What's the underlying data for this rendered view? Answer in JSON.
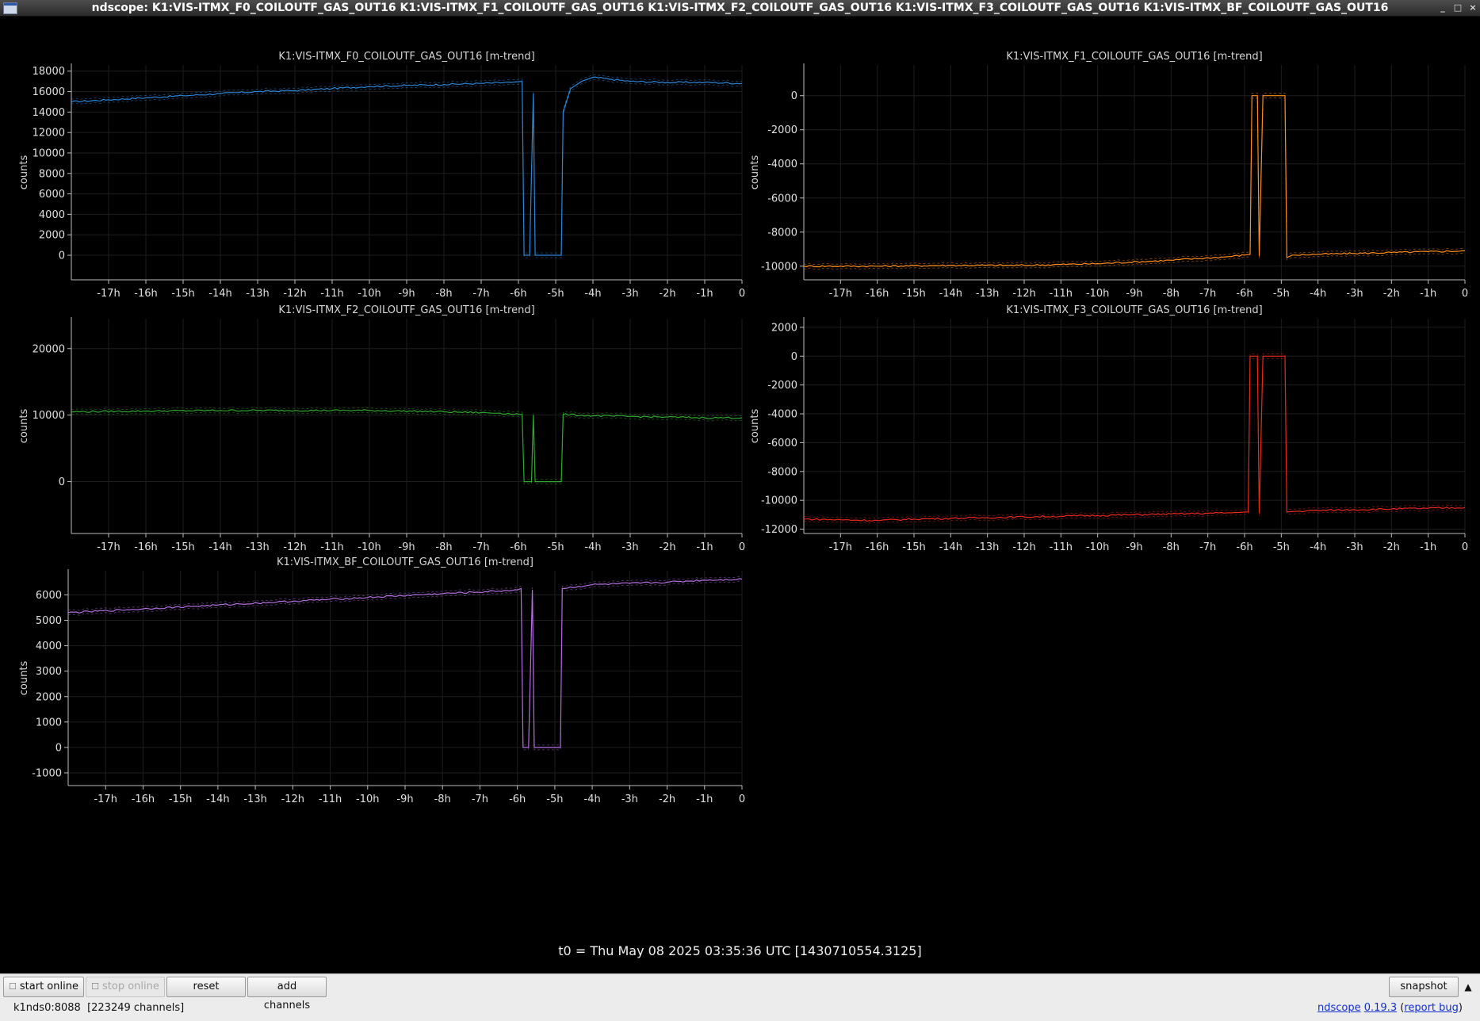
{
  "window": {
    "title": "ndscope: K1:VIS-ITMX_F0_COILOUTF_GAS_OUT16 K1:VIS-ITMX_F1_COILOUTF_GAS_OUT16 K1:VIS-ITMX_F2_COILOUTF_GAS_OUT16 K1:VIS-ITMX_F3_COILOUTF_GAS_OUT16 K1:VIS-ITMX_BF_COILOUTF_GAS_OUT16",
    "controls": {
      "minimize": "_",
      "maximize": "□",
      "close": "×"
    }
  },
  "x_ticks": [
    "-17h",
    "-16h",
    "-15h",
    "-14h",
    "-13h",
    "-12h",
    "-11h",
    "-10h",
    "-9h",
    "-8h",
    "-7h",
    "-6h",
    "-5h",
    "-4h",
    "-3h",
    "-2h",
    "-1h",
    "0"
  ],
  "plots": [
    {
      "title": "K1:VIS-ITMX_F0_COILOUTF_GAS_OUT16 [m-trend]",
      "ylabel": "counts",
      "color": "#2b86d9",
      "yticks": [
        "18000",
        "16000",
        "14000",
        "12000",
        "10000",
        "8000",
        "6000",
        "4000",
        "2000",
        "0"
      ]
    },
    {
      "title": "K1:VIS-ITMX_F1_COILOUTF_GAS_OUT16 [m-trend]",
      "ylabel": "counts",
      "color": "#ff8c1a",
      "yticks": [
        "0",
        "-2000",
        "-4000",
        "-6000",
        "-8000",
        "-10000"
      ]
    },
    {
      "title": "K1:VIS-ITMX_F2_COILOUTF_GAS_OUT16 [m-trend]",
      "ylabel": "counts",
      "color": "#2ea82e",
      "yticks": [
        "20000",
        "10000",
        "0"
      ]
    },
    {
      "title": "K1:VIS-ITMX_F3_COILOUTF_GAS_OUT16 [m-trend]",
      "ylabel": "counts",
      "color": "#e8281e",
      "yticks": [
        "2000",
        "0",
        "-2000",
        "-4000",
        "-6000",
        "-8000",
        "-10000",
        "-12000"
      ]
    },
    {
      "title": "K1:VIS-ITMX_BF_COILOUTF_GAS_OUT16 [m-trend]",
      "ylabel": "counts",
      "color": "#b36ee0",
      "yticks": [
        "6000",
        "5000",
        "4000",
        "3000",
        "2000",
        "1000",
        "0",
        "-1000"
      ]
    }
  ],
  "chart_data": [
    {
      "type": "line",
      "title": "K1:VIS-ITMX_F0_COILOUTF_GAS_OUT16 [m-trend]",
      "xlabel": "",
      "ylabel": "counts",
      "xlim": [
        -18,
        0
      ],
      "ylim": [
        -2400,
        18600
      ],
      "grid": true,
      "series": [
        {
          "x": [
            -18,
            -17,
            -16,
            -15,
            -14,
            -13,
            -12,
            -11,
            -10,
            -9,
            -8,
            -7,
            -6.2,
            -5.9,
            -5.85,
            -5.7,
            -5.6,
            -5.55,
            -5.4,
            -4.85,
            -4.8,
            -4.6,
            -4.3,
            -4,
            -3.5,
            -3,
            -2,
            -1,
            0
          ],
          "y": [
            15000,
            15200,
            15400,
            15600,
            15800,
            16000,
            16100,
            16300,
            16500,
            16600,
            16700,
            16800,
            16900,
            17000,
            0,
            0,
            15800,
            0,
            0,
            0,
            14000,
            16300,
            17000,
            17400,
            17200,
            17000,
            16900,
            16900,
            16800
          ]
        }
      ]
    },
    {
      "type": "line",
      "title": "K1:VIS-ITMX_F1_COILOUTF_GAS_OUT16 [m-trend]",
      "xlabel": "",
      "ylabel": "counts",
      "xlim": [
        -18,
        0
      ],
      "ylim": [
        -10800,
        1800
      ],
      "grid": true,
      "series": [
        {
          "x": [
            -18,
            -16,
            -14,
            -12,
            -10,
            -8,
            -6.5,
            -6,
            -5.85,
            -5.8,
            -5.65,
            -5.6,
            -5.5,
            -5.45,
            -5.4,
            -4.9,
            -4.85,
            -4.7,
            -4,
            -3,
            -2,
            -1,
            0
          ],
          "y": [
            -10000,
            -10000,
            -9950,
            -9950,
            -9850,
            -9650,
            -9450,
            -9350,
            -9300,
            0,
            0,
            -9400,
            0,
            0,
            0,
            0,
            -9500,
            -9350,
            -9300,
            -9250,
            -9200,
            -9150,
            -9100
          ]
        }
      ]
    },
    {
      "type": "line",
      "title": "K1:VIS-ITMX_F2_COILOUTF_GAS_OUT16 [m-trend]",
      "xlabel": "",
      "ylabel": "counts",
      "xlim": [
        -18,
        0
      ],
      "ylim": [
        -7800,
        24500
      ],
      "grid": true,
      "series": [
        {
          "x": [
            -18,
            -16,
            -14,
            -12,
            -10,
            -8,
            -6.5,
            -5.9,
            -5.85,
            -5.65,
            -5.6,
            -5.55,
            -5.4,
            -4.85,
            -4.8,
            -4,
            -3,
            -2,
            -1,
            0
          ],
          "y": [
            10500,
            10600,
            10700,
            10700,
            10700,
            10500,
            10300,
            10100,
            0,
            0,
            10000,
            0,
            0,
            0,
            10100,
            9900,
            9800,
            9700,
            9600,
            9600
          ]
        }
      ]
    },
    {
      "type": "line",
      "title": "K1:VIS-ITMX_F3_COILOUTF_GAS_OUT16 [m-trend]",
      "xlabel": "",
      "ylabel": "counts",
      "xlim": [
        -18,
        0
      ],
      "ylim": [
        -12300,
        2600
      ],
      "grid": true,
      "series": [
        {
          "x": [
            -18,
            -17,
            -16,
            -15,
            -14,
            -13,
            -12,
            -11,
            -10,
            -9,
            -8,
            -7,
            -6.2,
            -5.9,
            -5.85,
            -5.65,
            -5.6,
            -5.5,
            -5.4,
            -4.9,
            -4.85,
            -4.5,
            -4,
            -3,
            -2,
            -1,
            0
          ],
          "y": [
            -11300,
            -11350,
            -11400,
            -11300,
            -11250,
            -11200,
            -11150,
            -11100,
            -11050,
            -11000,
            -10950,
            -10900,
            -10850,
            -10800,
            0,
            0,
            -10900,
            0,
            0,
            0,
            -10800,
            -10750,
            -10700,
            -10650,
            -10600,
            -10550,
            -10500
          ]
        }
      ]
    },
    {
      "type": "line",
      "title": "K1:VIS-ITMX_BF_COILOUTF_GAS_OUT16 [m-trend]",
      "xlabel": "",
      "ylabel": "counts",
      "xlim": [
        -18,
        0
      ],
      "ylim": [
        -1500,
        6950
      ],
      "grid": true,
      "series": [
        {
          "x": [
            -18,
            -16,
            -14,
            -12,
            -10,
            -8,
            -6.5,
            -6,
            -5.9,
            -5.85,
            -5.7,
            -5.6,
            -5.55,
            -5.4,
            -4.85,
            -4.8,
            -4,
            -3,
            -2,
            -1,
            0
          ],
          "y": [
            5300,
            5450,
            5600,
            5750,
            5900,
            6050,
            6150,
            6200,
            6250,
            0,
            0,
            6200,
            0,
            0,
            0,
            6250,
            6400,
            6450,
            6500,
            6580,
            6620
          ]
        }
      ]
    }
  ],
  "t0_label": "t0 = Thu May 08 2025 03:35:36 UTC [1430710554.3125]",
  "toolbar": {
    "start_label": "start online",
    "stop_label": "stop online",
    "reset_label": "reset",
    "add_label": "add channels",
    "snapshot_label": "snapshot",
    "expand_icon": "▲"
  },
  "status": {
    "server": "k1nds0:8088  [223249 channels]",
    "app_link": "ndscope",
    "version_link": "0.19.3",
    "report_link": "report bug"
  }
}
